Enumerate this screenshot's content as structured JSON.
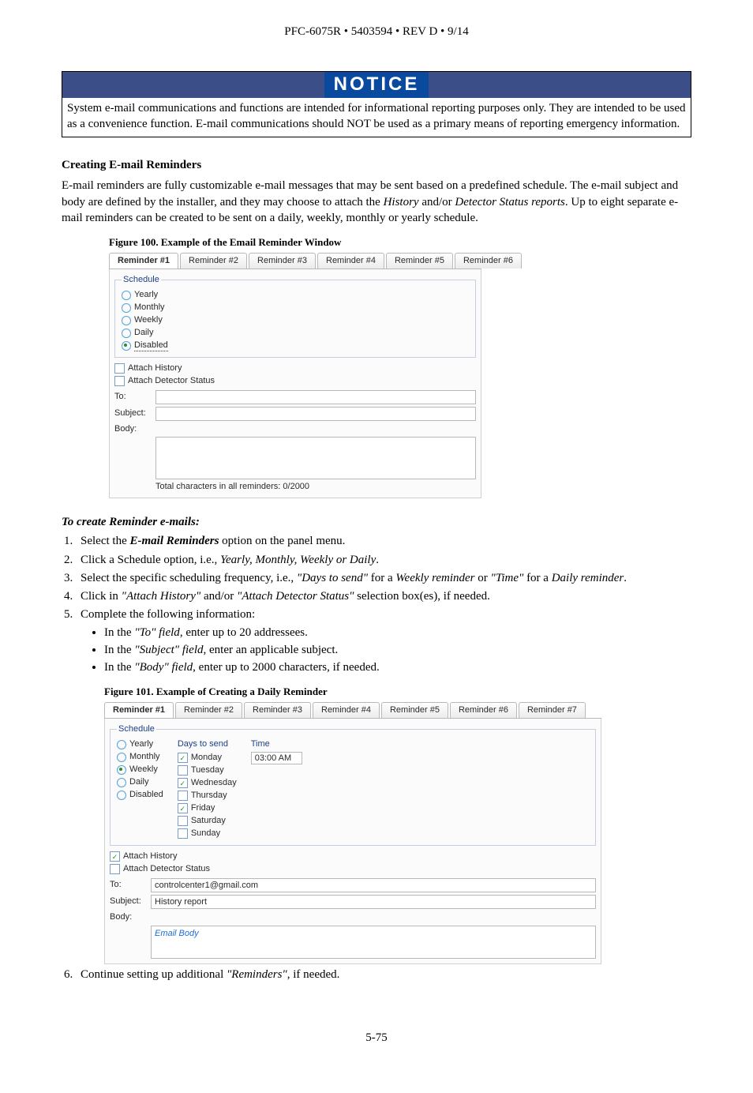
{
  "header": "PFC-6075R • 5403594 • REV D • 9/14",
  "notice": {
    "title": "NOTICE",
    "body": "System e-mail communications and functions are intended for informational reporting purposes only.  They are intended to be used as a convenience function. E-mail communications should NOT be used as a primary means of reporting emergency information."
  },
  "section_title": "Creating E-mail Reminders",
  "intro_p1a": "E-mail reminders are fully customizable e-mail messages that may be sent based on a predefined schedule. The e-mail subject and body are defined by the installer, and they may choose to attach the ",
  "intro_p1_hist": "History",
  "intro_p1b": " and/or ",
  "intro_p1_det": "Detector Status reports",
  "intro_p1c": ". Up to eight separate e-mail reminders can be created to be sent on a daily, weekly, monthly or yearly schedule.",
  "fig100_caption": "Figure 100. Example of the Email Reminder Window",
  "fig100": {
    "tabs": [
      "Reminder #1",
      "Reminder #2",
      "Reminder #3",
      "Reminder #4",
      "Reminder #5",
      "Reminder #6"
    ],
    "schedule_legend": "Schedule",
    "radios": [
      "Yearly",
      "Monthly",
      "Weekly",
      "Daily",
      "Disabled"
    ],
    "selected_radio": "Disabled",
    "attach_history": "Attach History",
    "attach_detector": "Attach Detector Status",
    "to_label": "To:",
    "subject_label": "Subject:",
    "body_label": "Body:",
    "char_count": "Total characters in all reminders: 0/2000"
  },
  "steps_title": "To create Reminder e-mails:",
  "steps": {
    "s1a": "Select the ",
    "s1b": "E-mail Reminders",
    "s1c": " option on the panel menu.",
    "s2a": "Click a Schedule option, i.e., ",
    "s2b": "Yearly, Monthly, Weekly or Daily",
    "s2c": ".",
    "s3a": "Select the specific scheduling frequency, i.e., ",
    "s3b": "\"Days to send\"",
    "s3c": " for a ",
    "s3d": "Weekly reminder",
    "s3e": " or ",
    "s3f": "\"Time\"",
    "s3g": " for a ",
    "s3h": "Daily reminder",
    "s3i": ".",
    "s4a": "Click in ",
    "s4b": "\"Attach History\"",
    "s4c": " and/or ",
    "s4d": "\"Attach Detector Status\"",
    "s4e": " selection box(es), if needed.",
    "s5": "Complete the following information:",
    "b1a": "In the ",
    "b1b": "\"To\" field",
    "b1c": ", enter up to 20 addressees.",
    "b2a": "In the ",
    "b2b": "\"Subject\" field",
    "b2c": ", enter an applicable subject.",
    "b3a": "In the ",
    "b3b": "\"Body\" field",
    "b3c": ", enter up to 2000 characters, if needed.",
    "s6a": "Continue setting up additional ",
    "s6b": "\"Reminders\"",
    "s6c": ", if needed."
  },
  "fig101_caption": "Figure 101. Example of Creating a Daily Reminder",
  "fig101": {
    "tabs": [
      "Reminder #1",
      "Reminder #2",
      "Reminder #3",
      "Reminder #4",
      "Reminder #5",
      "Reminder #6",
      "Reminder #7"
    ],
    "schedule_legend": "Schedule",
    "radios": [
      "Yearly",
      "Monthly",
      "Weekly",
      "Daily",
      "Disabled"
    ],
    "selected_radio": "Weekly",
    "days_head": "Days to send",
    "days": [
      {
        "label": "Monday",
        "checked": true
      },
      {
        "label": "Tuesday",
        "checked": false
      },
      {
        "label": "Wednesday",
        "checked": true
      },
      {
        "label": "Thursday",
        "checked": false
      },
      {
        "label": "Friday",
        "checked": true
      },
      {
        "label": "Saturday",
        "checked": false
      },
      {
        "label": "Sunday",
        "checked": false
      }
    ],
    "time_head": "Time",
    "time_value": "03:00 AM",
    "attach_history": "Attach History",
    "attach_history_checked": true,
    "attach_detector": "Attach Detector Status",
    "attach_detector_checked": false,
    "to_label": "To:",
    "to_value": "controlcenter1@gmail.com",
    "subject_label": "Subject:",
    "subject_value": "History report",
    "body_label": "Body:",
    "body_value": "Email Body"
  },
  "footer": "5-75"
}
